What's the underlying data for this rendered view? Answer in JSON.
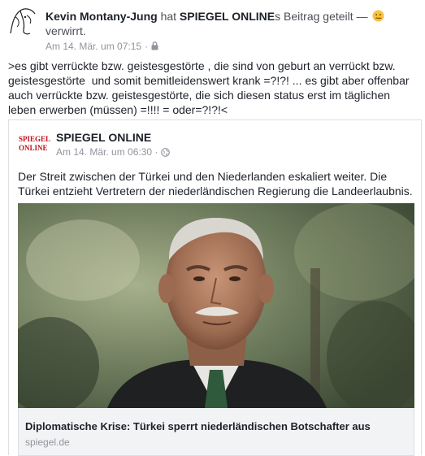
{
  "post": {
    "author": "Kevin Montany-Jung",
    "action": "hat",
    "shared_page": "SPIEGEL ONLINE",
    "shared_suffix": "s Beitrag geteilt — ",
    "feeling": "verwirrt.",
    "feeling_icon": "confused-face-emoji",
    "timestamp": "Am 14. Mär. um 07:15",
    "privacy_icon": "lock-icon",
    "text": ">es gibt verrückte bzw. geistesgestörte , die sind von geburt an verrückt bzw. geistesgestörte  und somit bemitleidenswert krank =?!?! ... es gibt aber offenbar auch verrückte bzw. geistesgestörte, die sich diesen status erst im täglichen leben erwerben (müssen) =!!!! = oder=?!?!<"
  },
  "shared": {
    "page_logo_line1": "SPIEGEL",
    "page_logo_line2": "ONLINE",
    "page_name": "SPIEGEL ONLINE",
    "timestamp": "Am 14. Mär. um 06:30",
    "privacy_icon": "globe-icon",
    "text": "Der Streit zwischen der Türkei und den Niederlanden eskaliert weiter. Die Türkei entzieht Vertretern der niederländischen Regierung die Landeerlaubnis.",
    "article_title": "Diplomatische Krise: Türkei sperrt niederländischen Botschafter aus",
    "article_source": "spiegel.de"
  },
  "colors": {
    "link": "#1d2129",
    "meta": "#90949c",
    "spiegel_red": "#c1121c",
    "card_bg": "#f2f3f5"
  }
}
